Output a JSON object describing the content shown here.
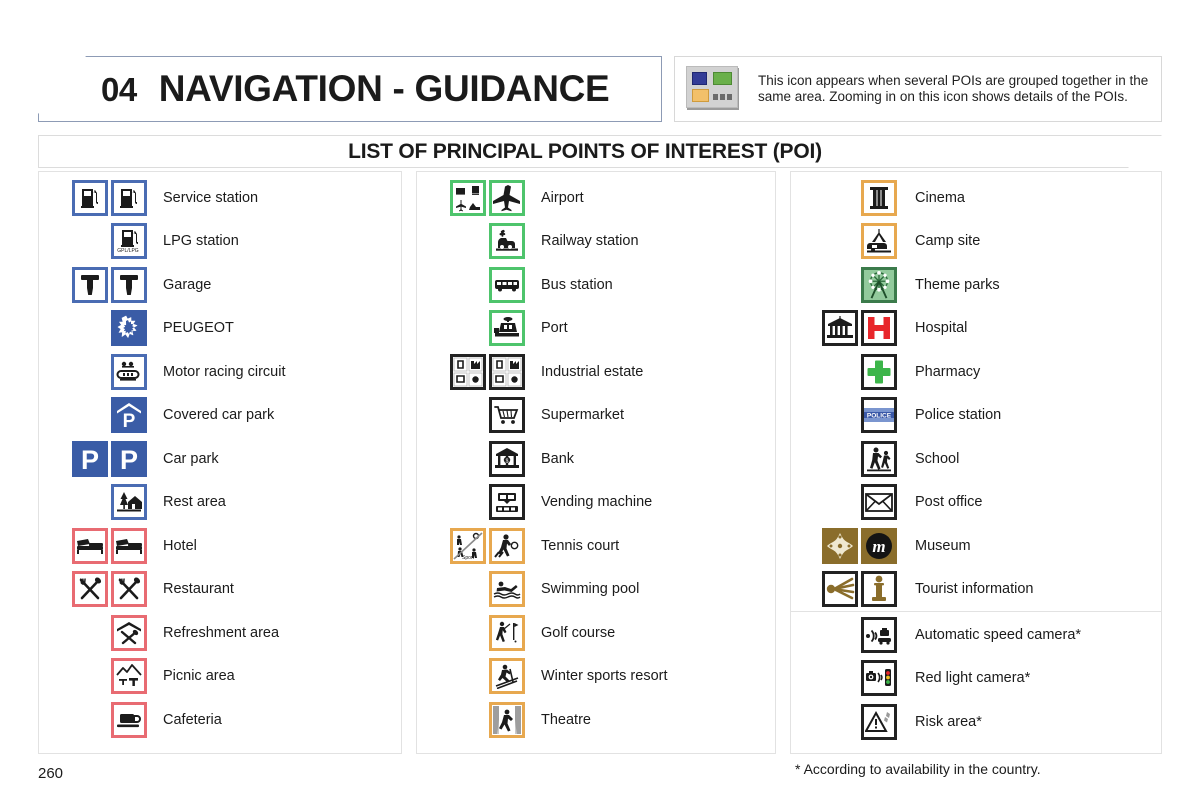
{
  "header": {
    "chapter_number": "04",
    "chapter_title": "NAVIGATION - GUIDANCE",
    "info_note": "This icon appears when several POIs are grouped together in the same area. Zooming in on this icon shows details of the POIs.",
    "info_icon_name": "grouped-poi-icon",
    "info_icon_colors": [
      "#333c96",
      "#6ab04a",
      "#f2c06a",
      "#6b6b6b"
    ]
  },
  "subtitle": "LIST OF PRINCIPAL POINTS OF INTEREST (POI)",
  "columns": [
    {
      "id": "column-1",
      "rows": [
        {
          "label": "Service station",
          "icons": [
            "fuel-pump-icon",
            "fuel-pump-icon"
          ],
          "style": "blue"
        },
        {
          "label": "LPG station",
          "icons": [
            "lpg-pump-icon"
          ],
          "style": "blue"
        },
        {
          "label": "Garage",
          "icons": [
            "garage-tool-icon",
            "garage-tool-icon"
          ],
          "style": "blue"
        },
        {
          "label": "PEUGEOT",
          "icons": [
            "peugeot-lion-icon"
          ],
          "style": "blue-fill"
        },
        {
          "label": "Motor racing circuit",
          "icons": [
            "racing-circuit-icon"
          ],
          "style": "blue"
        },
        {
          "label": "Covered car park",
          "icons": [
            "covered-parking-icon"
          ],
          "style": "blue-fill"
        },
        {
          "label": "Car park",
          "icons": [
            "parking-icon",
            "parking-icon"
          ],
          "style": "blue-fill"
        },
        {
          "label": "Rest area",
          "icons": [
            "rest-area-icon"
          ],
          "style": "blue"
        },
        {
          "label": "Hotel",
          "icons": [
            "bed-icon",
            "bed-icon"
          ],
          "style": "red"
        },
        {
          "label": "Restaurant",
          "icons": [
            "cutlery-icon",
            "cutlery-icon"
          ],
          "style": "red"
        },
        {
          "label": "Refreshment area",
          "icons": [
            "refreshment-icon"
          ],
          "style": "red"
        },
        {
          "label": "Picnic area",
          "icons": [
            "picnic-icon"
          ],
          "style": "red"
        },
        {
          "label": "Cafeteria",
          "icons": [
            "coffee-cup-icon"
          ],
          "style": "red"
        }
      ]
    },
    {
      "id": "column-2",
      "rows": [
        {
          "label": "Airport",
          "icons": [
            "transport-group-icon",
            "airplane-icon"
          ],
          "style": "green"
        },
        {
          "label": "Railway station",
          "icons": [
            "train-icon"
          ],
          "style": "green"
        },
        {
          "label": "Bus station",
          "icons": [
            "bus-icon"
          ],
          "style": "green"
        },
        {
          "label": "Port",
          "icons": [
            "ship-icon"
          ],
          "style": "green"
        },
        {
          "label": "Industrial estate",
          "icons": [
            "industry-group-icon",
            "industry-group-icon"
          ],
          "style": "black"
        },
        {
          "label": "Supermarket",
          "icons": [
            "shopping-cart-icon"
          ],
          "style": "black"
        },
        {
          "label": "Bank",
          "icons": [
            "bank-icon"
          ],
          "style": "black"
        },
        {
          "label": "Vending machine",
          "icons": [
            "vending-machine-icon"
          ],
          "style": "black"
        },
        {
          "label": "Tennis court",
          "icons": [
            "sports-group-icon",
            "tennis-player-icon"
          ],
          "style": "orange"
        },
        {
          "label": "Swimming pool",
          "icons": [
            "swimmer-icon"
          ],
          "style": "orange"
        },
        {
          "label": "Golf course",
          "icons": [
            "golfer-icon"
          ],
          "style": "orange"
        },
        {
          "label": "Winter sports resort",
          "icons": [
            "skier-icon"
          ],
          "style": "orange"
        },
        {
          "label": "Theatre",
          "icons": [
            "theatre-icon"
          ],
          "style": "orange"
        }
      ]
    },
    {
      "id": "column-3",
      "rows": [
        {
          "label": "Cinema",
          "icons": [
            "film-reel-icon"
          ],
          "style": "orange"
        },
        {
          "label": "Camp site",
          "icons": [
            "tent-caravan-icon"
          ],
          "style": "orange"
        },
        {
          "label": "Theme parks",
          "icons": [
            "ferris-wheel-icon"
          ],
          "style": "green-fill"
        },
        {
          "label": "Hospital",
          "icons": [
            "building-icon",
            "hospital-h-icon"
          ],
          "style": "black"
        },
        {
          "label": "Pharmacy",
          "icons": [
            "green-cross-icon"
          ],
          "style": "black"
        },
        {
          "label": "Police station",
          "icons": [
            "police-sign-icon"
          ],
          "style": "black"
        },
        {
          "label": "School",
          "icons": [
            "school-children-icon"
          ],
          "style": "black"
        },
        {
          "label": "Post office",
          "icons": [
            "envelope-icon"
          ],
          "style": "black"
        },
        {
          "label": "Museum",
          "icons": [
            "museum-ornament-icon",
            "museum-m-icon"
          ],
          "style": "brown"
        },
        {
          "label": "Tourist information",
          "icons": [
            "tourist-beam-icon",
            "information-i-icon"
          ],
          "style": "brown-w"
        },
        {
          "label": "Automatic speed camera*",
          "icons": [
            "speed-camera-icon"
          ],
          "style": "black",
          "after_separator": true
        },
        {
          "label": "Red light camera*",
          "icons": [
            "red-light-camera-icon"
          ],
          "style": "black"
        },
        {
          "label": "Risk area*",
          "icons": [
            "risk-area-icon"
          ],
          "style": "black"
        }
      ]
    }
  ],
  "footer": {
    "page_number": "260",
    "footnote": "* According to availability in the country."
  }
}
